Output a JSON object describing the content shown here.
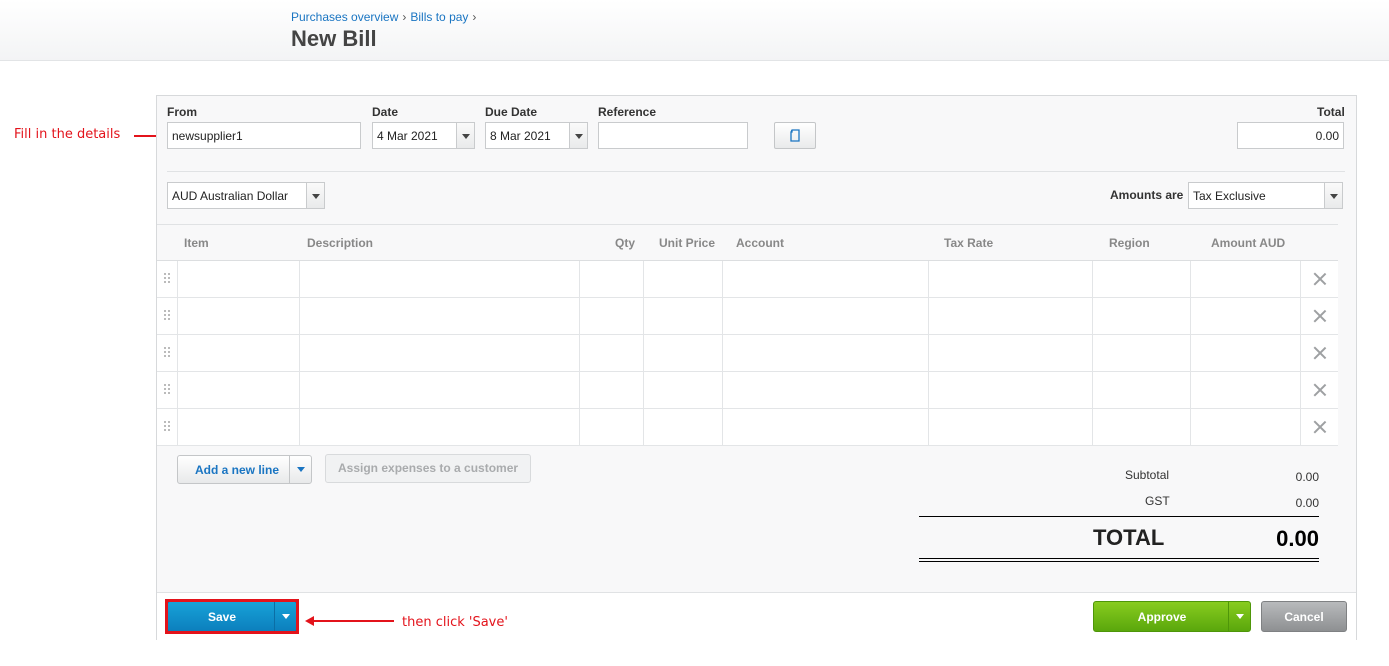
{
  "breadcrumb": {
    "item1": "Purchases overview",
    "item2": "Bills to pay",
    "sep": "›"
  },
  "page_title": "New Bill",
  "form": {
    "from_label": "From",
    "from_value": "newsupplier1",
    "date_label": "Date",
    "date_value": "4 Mar 2021",
    "due_date_label": "Due Date",
    "due_date_value": "8 Mar 2021",
    "reference_label": "Reference",
    "reference_value": "",
    "total_label": "Total",
    "total_value": "0.00",
    "currency_value": "AUD Australian Dollar",
    "amounts_are_label": "Amounts are",
    "amounts_are_value": "Tax Exclusive"
  },
  "table": {
    "headers": [
      "Item",
      "Description",
      "Qty",
      "Unit Price",
      "Account",
      "Tax Rate",
      "Region",
      "Amount AUD"
    ],
    "row_count": 5
  },
  "actions": {
    "add_line": "Add a new line",
    "assign_expenses": "Assign expenses to a customer"
  },
  "totals": {
    "subtotal_label": "Subtotal",
    "subtotal_value": "0.00",
    "gst_label": "GST",
    "gst_value": "0.00",
    "total_label": "TOTAL",
    "total_value": "0.00"
  },
  "footer": {
    "save": "Save",
    "approve": "Approve",
    "cancel": "Cancel"
  },
  "annotations": {
    "fill_details": "Fill in the details",
    "click_save": "then click 'Save'"
  },
  "colors": {
    "link": "#1a75c2",
    "save": "#0c7fbd",
    "approve": "#5aa70c",
    "annotation": "#e3131b"
  }
}
